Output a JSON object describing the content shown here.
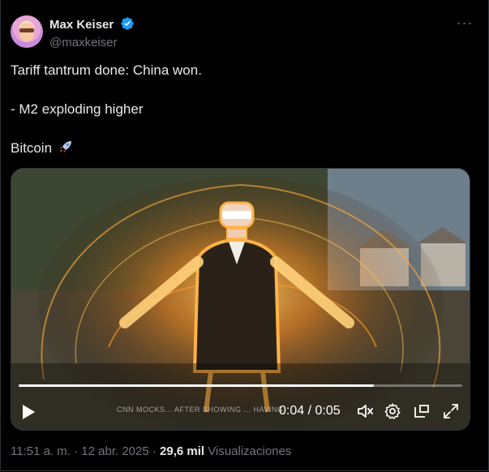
{
  "author": {
    "display_name": "Max Keiser",
    "handle": "@maxkeiser",
    "verified": true
  },
  "more_menu_label": "···",
  "tweet": {
    "lines": [
      "Tariff tantrum done: China won.",
      "- M2 exploding higher",
      "Bitcoin"
    ]
  },
  "video": {
    "time_display": "0:04 / 0:05",
    "progress": 0.8,
    "ticker_text": "CNN MOCKS... AFTER SHOWING ... HAVING"
  },
  "meta": {
    "time": "11:51 a. m.",
    "separator": "·",
    "date": "12 abr. 2025",
    "views_count": "29,6 mil",
    "views_label": "Visualizaciones"
  },
  "colors": {
    "background": "#000000",
    "text_primary": "#e7e9ea",
    "text_secondary": "#71767b",
    "verified": "#1d9bf0",
    "border": "#2f3336"
  }
}
